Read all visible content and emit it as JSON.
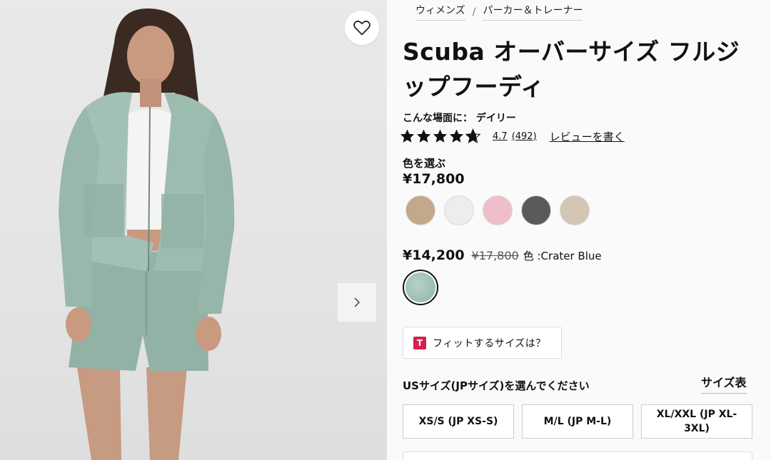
{
  "breadcrumb": [
    "ウィメンズ",
    "パーカー＆トレーナー"
  ],
  "breadcrumb_separator": "/",
  "product": {
    "title": "Scuba オーバーサイズ フルジップフーディ",
    "scene": "こんな場面に： デイリー",
    "rating": "4.7",
    "rating_count": "(492)",
    "rating_stars_value": 4.7,
    "review_link": "レビューを書く",
    "choose_color_label": "色を選ぶ",
    "price": "¥17,800",
    "sale_price": "¥14,200",
    "original_price": "¥17,800",
    "color_prefix": "色 : ",
    "color_name": "Crater Blue"
  },
  "swatches": [
    {
      "name": "tan-swatch",
      "color": "#c2a98a"
    },
    {
      "name": "white-swatch",
      "color": "#ededed"
    },
    {
      "name": "pink-swatch",
      "color": "#eebfcb"
    },
    {
      "name": "charcoal-swatch",
      "color": "#5a5a5a"
    },
    {
      "name": "oat-swatch",
      "color": "#d3c6b4"
    }
  ],
  "selected_swatch_color": "#9fc2b3",
  "fit": {
    "icon": "T",
    "label": "フィットするサイズは？"
  },
  "size_section": {
    "heading": "USサイズ(JPサイズ)を選んでください",
    "chart_link": "サイズ表",
    "sizes": [
      "XS/S (JP XS-S)",
      "M/L (JP M-L)",
      "XL/XXL (JP XL-3XL)"
    ]
  },
  "icons": {
    "wishlist": "heart-icon",
    "next": "chevron-right-icon"
  },
  "colors": {
    "accent": "#d6204b",
    "garment": "#9fbcb1",
    "background": "#fafafa"
  }
}
